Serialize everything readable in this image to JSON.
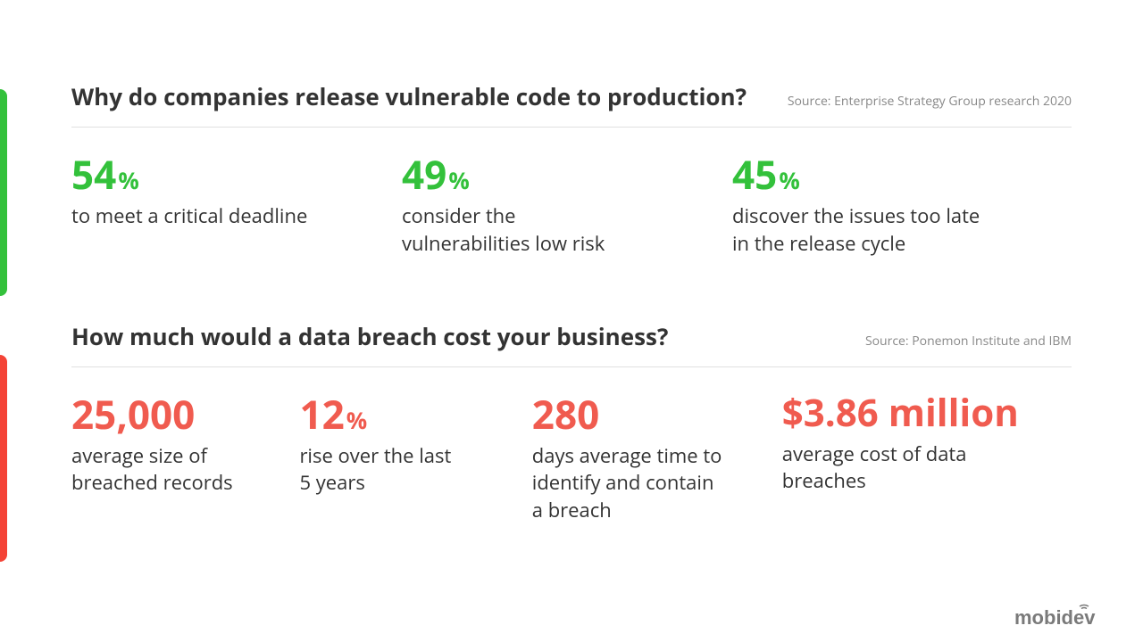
{
  "section1": {
    "title": "Why do companies release vulnerable code to production?",
    "source": "Source: Enterprise Strategy Group research 2020",
    "stats": [
      {
        "value": "54",
        "pct": "%",
        "label": "to meet a critical deadline"
      },
      {
        "value": "49",
        "pct": "%",
        "label": "consider the vulnerabilities low risk"
      },
      {
        "value": "45",
        "pct": "%",
        "label": "discover the issues too late in the release cycle"
      }
    ]
  },
  "section2": {
    "title": "How much would a data breach cost your business?",
    "source": "Source: Ponemon Institute and IBM",
    "stats": [
      {
        "value": "25,000",
        "pct": "",
        "label": "average size of breached records"
      },
      {
        "value": "12",
        "pct": "%",
        "label": "rise over the last 5 years"
      },
      {
        "value": "280",
        "pct": "",
        "label": "days  average time to identify and contain a breach"
      },
      {
        "value": "$3.86 million",
        "pct": "",
        "label": "average cost of data breaches"
      }
    ]
  },
  "logo": "mobidev"
}
